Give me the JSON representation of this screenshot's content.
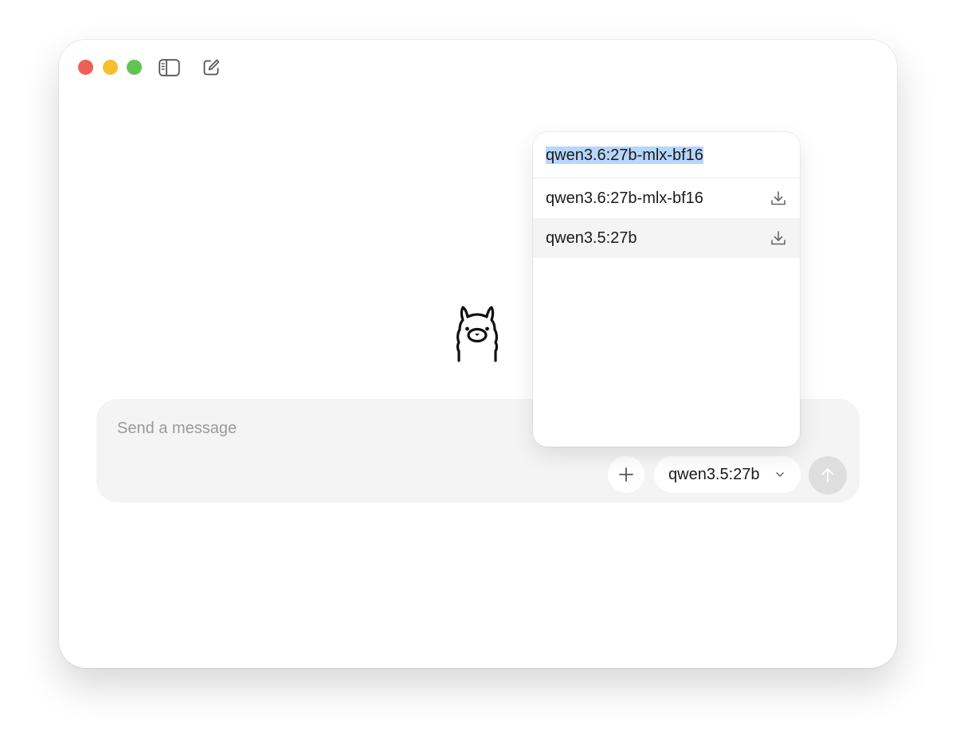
{
  "window": {
    "controls": [
      "close",
      "minimize",
      "maximize"
    ],
    "toolbar_icons": [
      "sidebar-toggle-icon",
      "new-chat-icon"
    ]
  },
  "composer": {
    "placeholder": "Send a message",
    "value": "",
    "add_icon": "plus-icon",
    "send_icon": "arrow-up-icon",
    "selected_model": "qwen3.5:27b"
  },
  "model_dropdown": {
    "search_value": "qwen3.6:27b-mlx-bf16",
    "search_text_selected": true,
    "items": [
      {
        "name": "qwen3.6:27b-mlx-bf16",
        "icon": "download-icon"
      },
      {
        "name": "qwen3.5:27b",
        "icon": "download-icon",
        "highlighted": true
      }
    ]
  },
  "colors": {
    "close": "#ee5f57",
    "minimize": "#f6bf2f",
    "maximize": "#5fc552",
    "composer_bg": "#f4f4f4",
    "selection": "#b6d6fb"
  }
}
